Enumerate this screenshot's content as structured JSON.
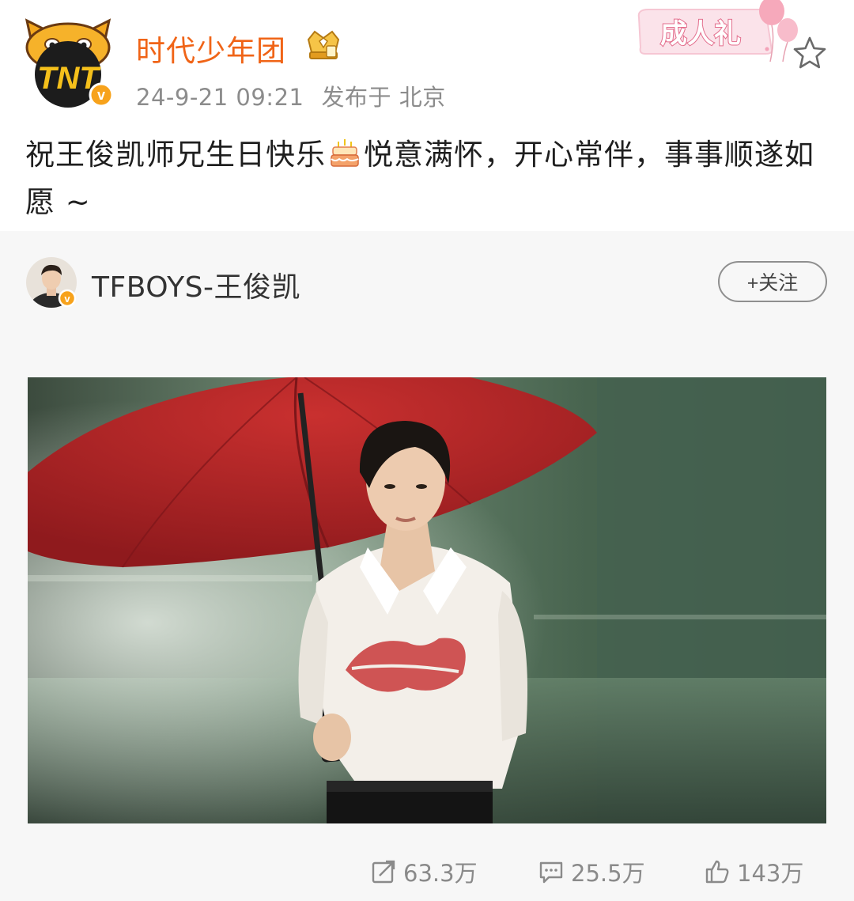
{
  "post": {
    "username": "时代少年团",
    "avatar_icon": "tnt-tiger-logo",
    "verified_icon": "verified-v-badge",
    "crown_icon": "crown-badge-icon",
    "timestamp": "24-9-21 09:21",
    "location": "发布于 北京",
    "event_badge": "成人礼",
    "text_part1": "祝王俊凯师兄生日快乐",
    "emoji_icon": "birthday-cake-emoji",
    "text_part2": "悦意满怀，开心常伴，事事顺遂如愿 ~"
  },
  "repost": {
    "original_author": "TFBOYS-王俊凯",
    "follow_label": "+关注",
    "photo_icon": "portrait-with-red-umbrella"
  },
  "actions": {
    "repost_count": "63.3万",
    "comment_count": "25.5万",
    "like_count": "143万"
  },
  "colors": {
    "username": "#f06417",
    "meta": "#8c8c8c",
    "card_bg": "#f7f7f7",
    "umbrella": "#b8262a"
  }
}
